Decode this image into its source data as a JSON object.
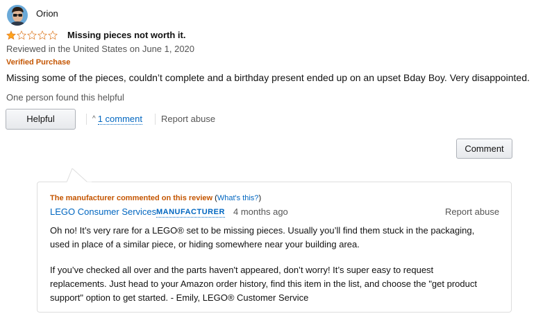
{
  "reviewer": {
    "name": "Orion",
    "avatar_icon": "avatar-icon"
  },
  "rating": {
    "filled": 1,
    "total": 5,
    "star_color": "#ffa41c"
  },
  "review": {
    "title": "Missing pieces not worth it.",
    "date": "Reviewed in the United States on June 1, 2020",
    "verified": "Verified Purchase",
    "body": "Missing some of the pieces, couldn’t complete and a birthday present ended up on an upset Bday Boy. Very disappointed.",
    "helpful_count": "One person found this helpful"
  },
  "actions": {
    "helpful_label": "Helpful",
    "comments_label": "1 comment",
    "report_abuse_label": "Report abuse",
    "comment_button_label": "Comment"
  },
  "manufacturer_comment": {
    "header": "The manufacturer commented on this review",
    "paren_open": " (",
    "whats_this": "What's this?",
    "paren_close": ")",
    "name": "LEGO Consumer Services",
    "badge": "MANUFACTURER",
    "time": "4 months ago",
    "report_abuse_label": "Report abuse",
    "paragraph1": [
      "Oh no! It’s very rare for a LEGO® set to be missing pieces. Usually you’ll find them stuck in the packaging,",
      "used in place of a similar piece, or hiding somewhere near your building area."
    ],
    "paragraph2": [
      "If you’ve checked all over and the parts haven't appeared, don’t worry! It’s super easy to request",
      "replacements. Just head to your Amazon order history, find this item in the list, and choose the \"get product",
      "support\" option to get started. - Emily, LEGO® Customer Service"
    ]
  },
  "colors": {
    "link": "#0066c0",
    "accent_orange": "#c45500",
    "muted": "#555555"
  }
}
